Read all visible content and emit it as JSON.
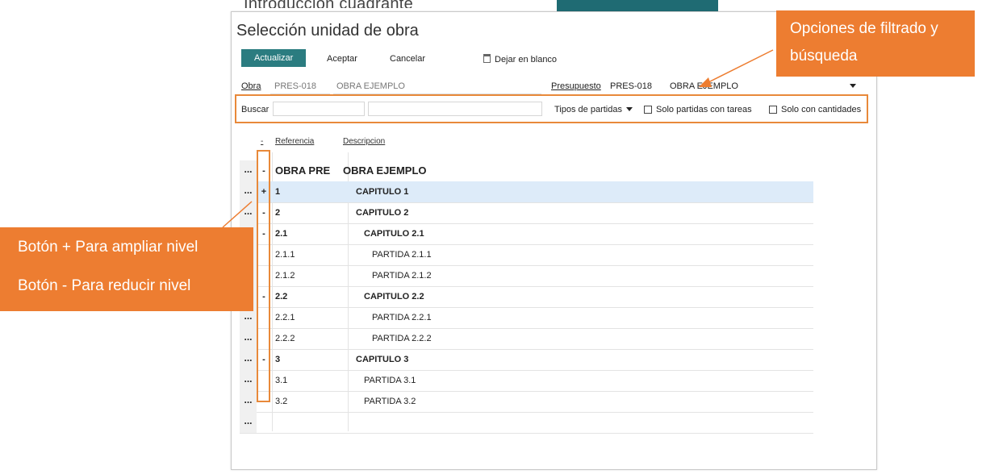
{
  "background": {
    "title": "Introduccion cuadrante"
  },
  "dialog": {
    "title": "Selección unidad de obra",
    "toolbar": {
      "update": "Actualizar",
      "accept": "Aceptar",
      "cancel": "Cancelar",
      "clear": "Dejar en blanco"
    },
    "obra": {
      "label": "Obra",
      "code": "PRES-018",
      "name": "OBRA EJEMPLO"
    },
    "presupuesto": {
      "label": "Presupuesto",
      "code": "PRES-018",
      "name": "OBRA EJEMPLO"
    },
    "search": {
      "label": "Buscar",
      "field1": "",
      "field2": "",
      "field3": ""
    },
    "filters": {
      "tipos_label": "Tipos de partidas",
      "solo_tareas": "Solo partidas con tareas",
      "solo_cantidades": "Solo con cantidades"
    },
    "grid": {
      "col_toggle": "-",
      "col_ref": "Referencia",
      "col_desc": "Descripcion",
      "rows": [
        {
          "dots": "...",
          "toggle": "-",
          "ref": "OBRA PRE",
          "desc": "OBRA EJEMPLO"
        },
        {
          "dots": "...",
          "toggle": "+",
          "ref": "1",
          "desc": "CAPITULO 1"
        },
        {
          "dots": "...",
          "toggle": "-",
          "ref": "2",
          "desc": "CAPITULO 2"
        },
        {
          "dots": "...",
          "toggle": "-",
          "ref": "2.1",
          "desc": "CAPITULO 2.1"
        },
        {
          "dots": "...",
          "toggle": "",
          "ref": "2.1.1",
          "desc": "PARTIDA 2.1.1"
        },
        {
          "dots": "...",
          "toggle": "",
          "ref": "2.1.2",
          "desc": "PARTIDA 2.1.2"
        },
        {
          "dots": "...",
          "toggle": "-",
          "ref": "2.2",
          "desc": "CAPITULO 2.2"
        },
        {
          "dots": "...",
          "toggle": "",
          "ref": "2.2.1",
          "desc": "PARTIDA 2.2.1"
        },
        {
          "dots": "...",
          "toggle": "",
          "ref": "2.2.2",
          "desc": "PARTIDA 2.2.2"
        },
        {
          "dots": "...",
          "toggle": "-",
          "ref": "3",
          "desc": "CAPITULO 3"
        },
        {
          "dots": "...",
          "toggle": "",
          "ref": "3.1",
          "desc": "PARTIDA 3.1"
        },
        {
          "dots": "...",
          "toggle": "",
          "ref": "3.2",
          "desc": "PARTIDA 3.2"
        },
        {
          "dots": "...",
          "toggle": "",
          "ref": "",
          "desc": ""
        }
      ]
    }
  },
  "callouts": {
    "top_line1": "Opciones de filtrado y",
    "top_line2": "búsqueda",
    "left_line1": "Botón + Para ampliar nivel",
    "left_line2": "Botón - Para reducir nivel"
  },
  "colors": {
    "accent_orange": "#ed7d31",
    "primary_button": "#2b7c80",
    "selected_row": "#ddebf9"
  }
}
